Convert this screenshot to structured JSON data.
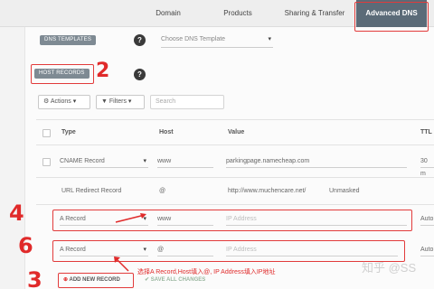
{
  "tabs": [
    {
      "label": "Domain",
      "active": false
    },
    {
      "label": "Products",
      "active": false
    },
    {
      "label": "Sharing & Transfer",
      "active": false
    },
    {
      "label": "Advanced DNS",
      "active": true
    }
  ],
  "dns_templates": {
    "label": "DNS TEMPLATES",
    "select_placeholder": "Choose DNS Template"
  },
  "host_records": {
    "label": "HOST RECORDS"
  },
  "toolbar": {
    "actions": "Actions",
    "filters": "Filters",
    "search_placeholder": "Search"
  },
  "table": {
    "headers": {
      "type": "Type",
      "host": "Host",
      "value": "Value",
      "ttl": "TTL"
    },
    "rows": [
      {
        "type": "CNAME Record",
        "host": "www",
        "value": "parkingpage.namecheap.com",
        "ttl": "30 m"
      },
      {
        "type": "URL Redirect Record",
        "host": "@",
        "value": "http://www.muchencare.net/",
        "extra": "Unmasked"
      },
      {
        "type": "A Record",
        "host": "www",
        "value_placeholder": "IP Address",
        "ttl": "Auto"
      },
      {
        "type": "A Record",
        "host": "@",
        "value_placeholder": "IP Address",
        "ttl": "Auto"
      }
    ]
  },
  "actions": {
    "add_new_record": "ADD NEW RECORD",
    "save_all_changes": "SAVE ALL CHANGES"
  },
  "annotations": {
    "n2": "2",
    "n4": "4",
    "n6": "6",
    "n3": "3",
    "note": "选择A Record,Host填入@, IP Address填入IP地址"
  },
  "watermark": "知乎 @SS",
  "colors": {
    "active_tab": "#5b6b78",
    "annotation_red": "#e02a2a"
  }
}
